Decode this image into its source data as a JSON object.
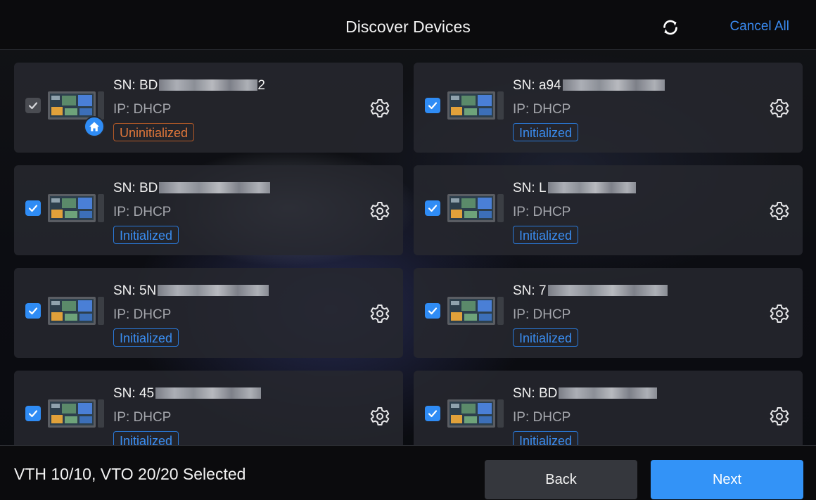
{
  "header": {
    "title": "Discover Devices",
    "refresh_icon": "refresh-icon",
    "cancel_all_label": "Cancel All"
  },
  "colors": {
    "accent": "#3393f7",
    "initialized": "#3a8df0",
    "uninitialized": "#e0773a"
  },
  "devices": [
    {
      "sn_prefix": "SN: BD",
      "sn_suffix": "2",
      "ip": "IP: DHCP",
      "status": "Uninitialized",
      "status_kind": "uninit",
      "checked": true,
      "check_style": "muted",
      "home_badge": true
    },
    {
      "sn_prefix": "SN: a94",
      "sn_suffix": "",
      "ip": "IP: DHCP",
      "status": "Initialized",
      "status_kind": "init",
      "checked": true,
      "check_style": "accent",
      "home_badge": false
    },
    {
      "sn_prefix": "SN: BD",
      "sn_suffix": "",
      "ip": "IP: DHCP",
      "status": "Initialized",
      "status_kind": "init",
      "checked": true,
      "check_style": "accent",
      "home_badge": false
    },
    {
      "sn_prefix": "SN: L",
      "sn_suffix": "",
      "ip": "IP: DHCP",
      "status": "Initialized",
      "status_kind": "init",
      "checked": true,
      "check_style": "accent",
      "home_badge": false
    },
    {
      "sn_prefix": "SN: 5N",
      "sn_suffix": "",
      "ip": "IP: DHCP",
      "status": "Initialized",
      "status_kind": "init",
      "checked": true,
      "check_style": "accent",
      "home_badge": false
    },
    {
      "sn_prefix": "SN: 7",
      "sn_suffix": "",
      "ip": "IP: DHCP",
      "status": "Initialized",
      "status_kind": "init",
      "checked": true,
      "check_style": "accent",
      "home_badge": false
    },
    {
      "sn_prefix": "SN: 45",
      "sn_suffix": "",
      "ip": "IP: DHCP",
      "status": "Initialized",
      "status_kind": "init",
      "checked": true,
      "check_style": "accent",
      "home_badge": false
    },
    {
      "sn_prefix": "SN: BD",
      "sn_suffix": "",
      "ip": "IP: DHCP",
      "status": "Initialized",
      "status_kind": "init",
      "checked": true,
      "check_style": "accent",
      "home_badge": false
    }
  ],
  "footer": {
    "summary": "VTH 10/10, VTO 20/20 Selected",
    "back_label": "Back",
    "next_label": "Next"
  }
}
